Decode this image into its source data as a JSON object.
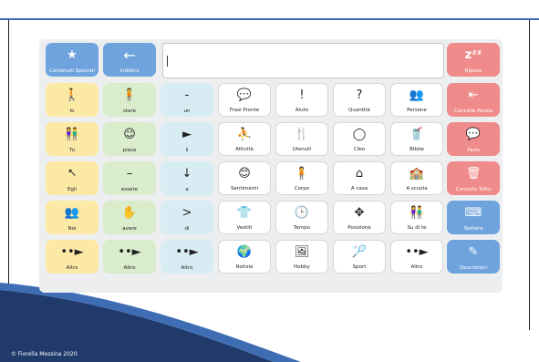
{
  "footer": {
    "copyright": "© Fiorella Messina 2020"
  },
  "colors": {
    "blue": "#6fa3dd",
    "red": "#f08b8b",
    "yellow": "#fde9a6",
    "green": "#d9eccb",
    "teal": "#d8ecf3",
    "accent_line": "#3f6db3"
  },
  "top_row": {
    "core_label": "Contenuti Speciali",
    "core_icon": "star-icon",
    "back_label": "Indietro",
    "back_icon": "back-arrow-icon",
    "message_text": "",
    "sleep_label": "Riposo",
    "sleep_icon": "zzz-icon"
  },
  "grid": [
    [
      {
        "label": "Io",
        "icon": "person-self-icon",
        "sym": "🚶",
        "color": "yellow"
      },
      {
        "label": "stare",
        "icon": "stand-icon",
        "sym": "🧍",
        "color": "green"
      },
      {
        "label": "un",
        "icon": "dash-icon",
        "sym": "-",
        "color": "teal"
      },
      {
        "label": "Frasi Pronte",
        "icon": "speech-bubbles-icon",
        "sym": "💬",
        "color": "white"
      },
      {
        "label": "Aiuto",
        "icon": "exclamation-icon",
        "sym": "!",
        "color": "white"
      },
      {
        "label": "Quantità",
        "icon": "quantity-icon",
        "sym": "?",
        "color": "white"
      },
      {
        "label": "Persone",
        "icon": "people-icon",
        "sym": "👥",
        "color": "white"
      },
      {
        "label": "Cancella Parola",
        "icon": "delete-word-icon",
        "sym": "⇤",
        "color": "red"
      }
    ],
    [
      {
        "label": "Tu",
        "icon": "you-icon",
        "sym": "👫",
        "color": "yellow"
      },
      {
        "label": "piace",
        "icon": "like-icon",
        "sym": "☺",
        "color": "green"
      },
      {
        "label": "il",
        "icon": "arrow-right-icon",
        "sym": "►",
        "color": "teal"
      },
      {
        "label": "Attività",
        "icon": "activity-icon",
        "sym": "⛹",
        "color": "white"
      },
      {
        "label": "Utensili",
        "icon": "utensils-icon",
        "sym": "🍴",
        "color": "white"
      },
      {
        "label": "Cibo",
        "icon": "plate-icon",
        "sym": "◯",
        "color": "white"
      },
      {
        "label": "Bibite",
        "icon": "drink-icon",
        "sym": "🥤",
        "color": "white"
      },
      {
        "label": "Parla",
        "icon": "speak-icon",
        "sym": "💬",
        "color": "red"
      }
    ],
    [
      {
        "label": "Egli",
        "icon": "he-icon",
        "sym": "⭦",
        "color": "yellow"
      },
      {
        "label": "essere",
        "icon": "be-icon",
        "sym": "–",
        "color": "green"
      },
      {
        "label": "a",
        "icon": "to-icon",
        "sym": "↓",
        "color": "teal"
      },
      {
        "label": "Sentimenti",
        "icon": "feelings-icon",
        "sym": "😊",
        "color": "white"
      },
      {
        "label": "Corpo",
        "icon": "body-icon",
        "sym": "🧍",
        "color": "white"
      },
      {
        "label": "A casa",
        "icon": "home-icon",
        "sym": "⌂",
        "color": "white"
      },
      {
        "label": "A scuola",
        "icon": "school-icon",
        "sym": "🏫",
        "color": "white"
      },
      {
        "label": "Cancella Tutto",
        "icon": "trash-icon",
        "sym": "🗑",
        "color": "red"
      }
    ],
    [
      {
        "label": "Noi",
        "icon": "we-icon",
        "sym": "👥",
        "color": "yellow"
      },
      {
        "label": "avere",
        "icon": "have-icon",
        "sym": "✋",
        "color": "green"
      },
      {
        "label": "di",
        "icon": "of-icon",
        "sym": ">",
        "color": "teal"
      },
      {
        "label": "Vestiti",
        "icon": "clothes-icon",
        "sym": "👕",
        "color": "white"
      },
      {
        "label": "Tempo",
        "icon": "clock-icon",
        "sym": "🕒",
        "color": "white"
      },
      {
        "label": "Posizione",
        "icon": "position-icon",
        "sym": "✥",
        "color": "white"
      },
      {
        "label": "Su di te",
        "icon": "about-you-icon",
        "sym": "👫",
        "color": "white"
      },
      {
        "label": "Tastiera",
        "icon": "keyboard-icon",
        "sym": "⌨",
        "color": "blue"
      }
    ],
    [
      {
        "label": "Altro",
        "icon": "more-icon",
        "sym": "••►",
        "color": "yellow"
      },
      {
        "label": "Altro",
        "icon": "more-icon",
        "sym": "••►",
        "color": "green"
      },
      {
        "label": "Altro",
        "icon": "more-icon",
        "sym": "••►",
        "color": "teal"
      },
      {
        "label": "Notizie",
        "icon": "news-icon",
        "sym": "🌍",
        "color": "white"
      },
      {
        "label": "Hobby",
        "icon": "hobby-icon",
        "sym": "🖼",
        "color": "white"
      },
      {
        "label": "Sport",
        "icon": "sport-icon",
        "sym": "🏸",
        "color": "white"
      },
      {
        "label": "Altro",
        "icon": "more-icon",
        "sym": "••►",
        "color": "white"
      },
      {
        "label": "Descrizioni",
        "icon": "describe-icon",
        "sym": "✎",
        "color": "blue"
      }
    ]
  ]
}
